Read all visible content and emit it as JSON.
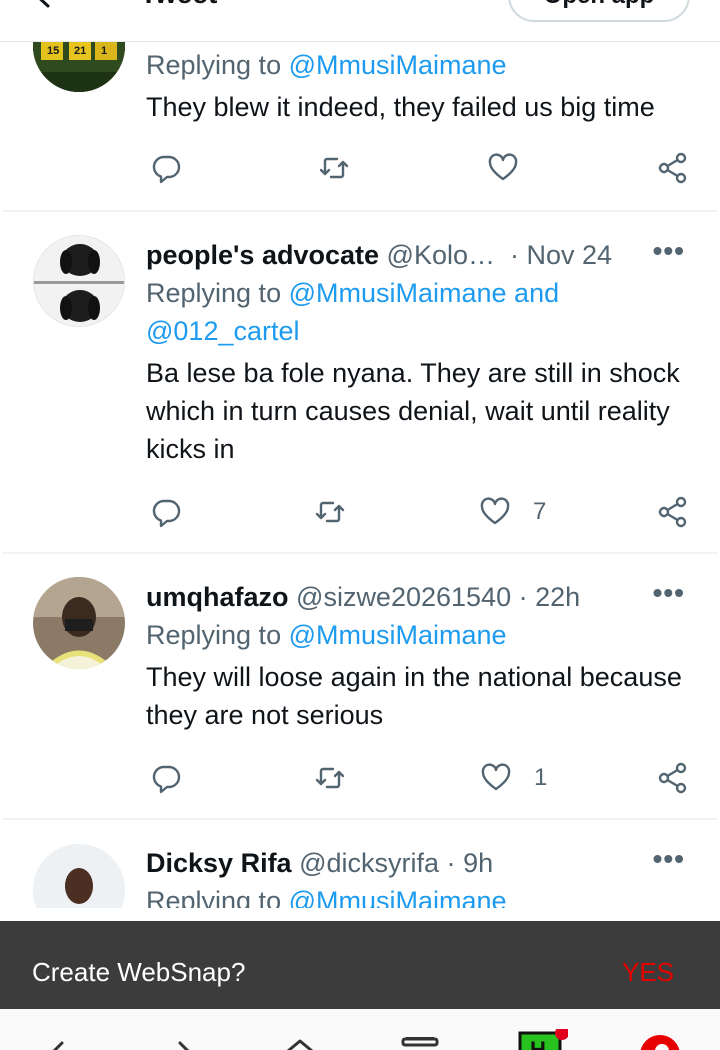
{
  "header": {
    "title": "Tweet",
    "open_app_label": "Open app"
  },
  "tweets": [
    {
      "display_name": "",
      "handle": "",
      "time": "",
      "reply_prefix": "Replying to ",
      "reply_mentions": "@MmusiMaimane",
      "text": "They blew it indeed, they failed us big time",
      "likes": ""
    },
    {
      "display_name": "people's advocate",
      "handle": "@Kolo…",
      "separator": "·",
      "time": "Nov 24",
      "reply_prefix": "Replying to ",
      "reply_mentions": "@MmusiMaimane and @012_cartel",
      "text": "Ba lese ba fole nyana. They are still in shock which in turn causes denial, wait until reality kicks in",
      "likes": "7"
    },
    {
      "display_name": "umqhafazo",
      "handle": "@sizwe20261540",
      "separator": "·",
      "time": "22h",
      "reply_prefix": "Replying to ",
      "reply_mentions": "@MmusiMaimane",
      "text": "They will loose again in the national because they are not serious",
      "likes": "1"
    },
    {
      "display_name": "Dicksy Rifa",
      "handle": "@dicksyrifa",
      "separator": "·",
      "time": "9h",
      "reply_prefix": "Replying to ",
      "reply_mentions": "@MmusiMaimane",
      "text": "",
      "likes": ""
    }
  ],
  "more_glyph": "•••",
  "websnap": {
    "label": "Create WebSnap?",
    "yes_label": "YES"
  },
  "colors": {
    "accent": "#1d9bf0",
    "muted": "#536471",
    "websnap_bg": "#3c3c3c",
    "yes": "#e60000"
  },
  "icons": [
    "back-arrow-icon",
    "reply-icon",
    "retweet-icon",
    "like-icon",
    "share-icon",
    "more-icon",
    "nav-back-icon",
    "nav-forward-icon",
    "nav-home-icon",
    "nav-tabs-icon",
    "nav-app-icon",
    "vodafone-logo-icon"
  ]
}
